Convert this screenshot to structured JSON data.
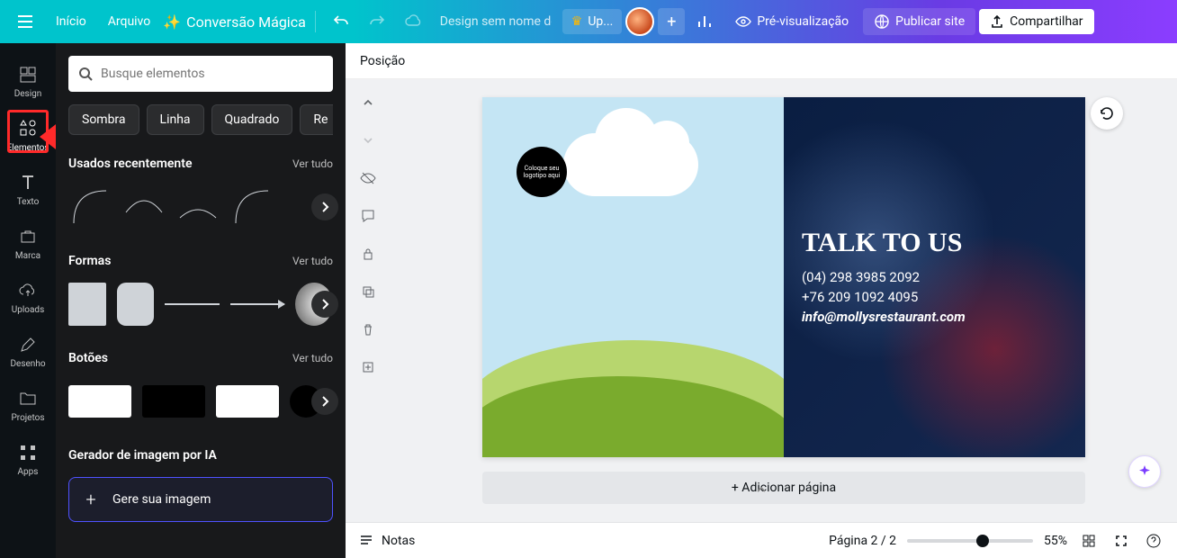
{
  "topbar": {
    "home": "Início",
    "file": "Arquivo",
    "magic": "Conversão Mágica",
    "design_name": "Design sem nome de...",
    "up": "Up...",
    "preview": "Pré-visualização",
    "publish": "Publicar site",
    "share": "Compartilhar"
  },
  "leftnav": {
    "design": "Design",
    "elements": "Elementos",
    "text": "Texto",
    "brand": "Marca",
    "uploads": "Uploads",
    "draw": "Desenho",
    "projects": "Projetos",
    "apps": "Apps"
  },
  "elements_panel": {
    "search_placeholder": "Busque elementos",
    "chips": [
      "Sombra",
      "Linha",
      "Quadrado",
      "Re"
    ],
    "recent": "Usados recentemente",
    "see_all": "Ver tudo",
    "shapes": "Formas",
    "buttons": "Botões",
    "ai_gen": "Gerador de imagem por IA",
    "gen_cta": "Gere sua imagem"
  },
  "canvas": {
    "position": "Posição",
    "logo_text": "Coloque seu logotipo aqui",
    "talk_title": "TALK TO US",
    "phone1": "(04) 298 3985 2092",
    "phone2": "+76 209 1092 4095",
    "email": "info@mollysrestaurant.com",
    "add_page": "+ Adicionar página"
  },
  "footer": {
    "notes": "Notas",
    "page_info": "Página 2 / 2",
    "zoom": "55%"
  }
}
